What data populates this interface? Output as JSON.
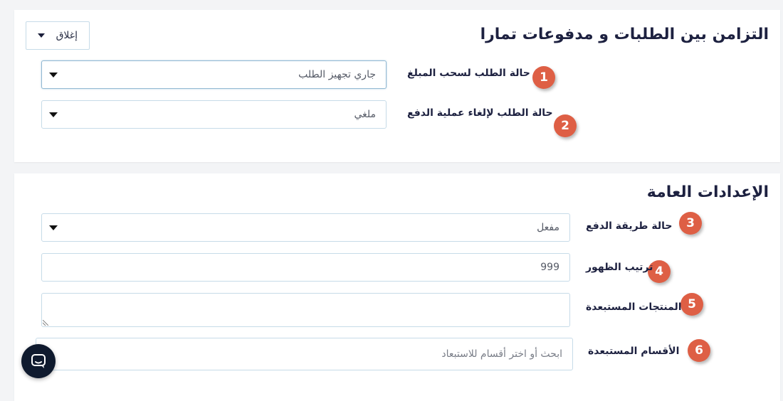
{
  "sync_section": {
    "title": "التزامن بين الطلبات و مدفوعات تمارا",
    "close_label": "إغلاق",
    "fields": [
      {
        "number": "1",
        "label": "حالة الطلب لسحب المبلغ",
        "value": "جاري تجهيز الطلب"
      },
      {
        "number": "2",
        "label": "حالة الطلب لإلغاء عملية الدفع",
        "value": "ملغي"
      }
    ]
  },
  "general_section": {
    "title": "الإعدادات العامة",
    "fields": [
      {
        "number": "3",
        "label": "حالة طريقة الدفع",
        "value": "مفعل"
      },
      {
        "number": "4",
        "label": "ترتيب الظهور",
        "value": "999"
      },
      {
        "number": "5",
        "label": "المنتجات المستبعدة",
        "value": ""
      },
      {
        "number": "6",
        "label": "الأقسام المستبعدة",
        "value": "",
        "placeholder": "ابحث أو اختر أقسام للاستبعاد"
      }
    ]
  },
  "colors": {
    "badge": "#de5f45",
    "title": "#1d2140",
    "field_border": "#c6dbe8",
    "chat_launcher": "#0f1a2e"
  },
  "icons": {
    "chat": "chat-bubble-icon",
    "dropdown": "caret-down-icon"
  }
}
